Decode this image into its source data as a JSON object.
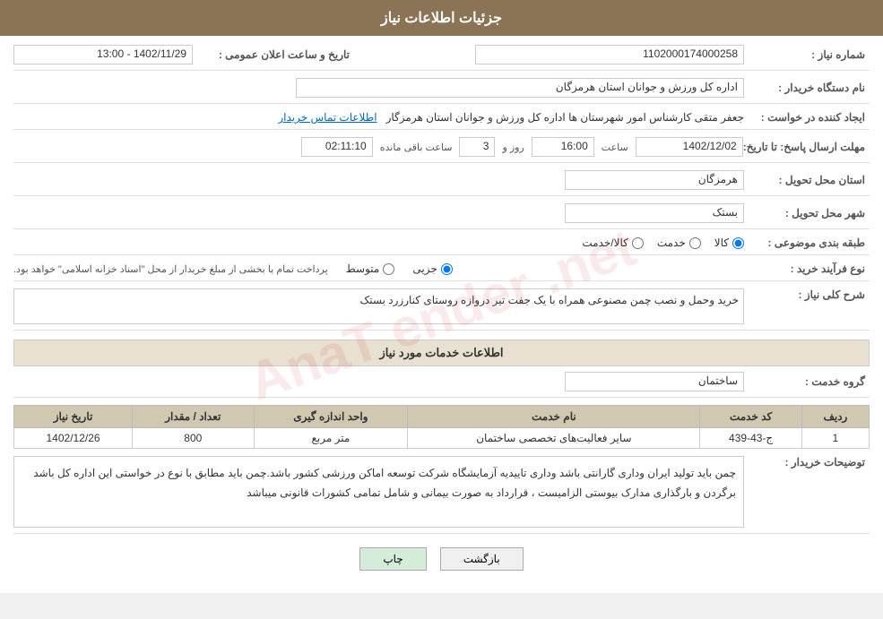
{
  "header": {
    "title": "جزئیات اطلاعات نیاز"
  },
  "fields": {
    "need_number_label": "شماره نیاز :",
    "need_number_value": "1102000174000258",
    "buyer_org_label": "نام دستگاه خریدار :",
    "buyer_org_value": "اداره کل ورزش و جوانان استان هرمزگان",
    "creator_label": "ایجاد کننده در خواست :",
    "creator_value": "جعفر متقی کارشناس امور شهرستان ها اداره کل ورزش و جوانان استان هرمزگار",
    "contact_link": "اطلاعات تماس خریدار",
    "send_deadline_label": "مهلت ارسال پاسخ: تا تاریخ:",
    "date_value": "1402/12/02",
    "time_label": "ساعت",
    "time_value": "16:00",
    "day_label": "روز و",
    "day_value": "3",
    "remaining_label": "ساعت باقی مانده",
    "remaining_value": "02:11:10",
    "province_label": "استان محل تحویل :",
    "province_value": "هرمزگان",
    "city_label": "شهر محل تحویل :",
    "city_value": "بستک",
    "category_label": "طبقه بندی موضوعی :",
    "category_kala": "کالا",
    "category_khedmat": "خدمت",
    "category_kala_khedmat": "کالا/خدمت",
    "process_label": "نوع فرآیند خرید :",
    "process_jozei": "جزیی",
    "process_motovaset": "متوسط",
    "process_description": "پرداخت تمام یا بخشی از مبلغ خریدار از محل \"اسناد خزانه اسلامی\" خواهد بود.",
    "need_summary_label": "شرح کلی نیاز :",
    "need_summary_value": "خرید وحمل  و نصب چمن مصنوعی همراه با یک جفت تیر دروازه روستای کنارزرد بستک",
    "services_header": "اطلاعات خدمات مورد نیاز",
    "service_group_label": "گروه خدمت :",
    "service_group_value": "ساختمان",
    "public_datetime_label": "تاریخ و ساعت اعلان عمومی :",
    "public_datetime_value": "1402/11/29 - 13:00",
    "table": {
      "headers": [
        "ردیف",
        "کد خدمت",
        "نام خدمت",
        "واحد اندازه گیری",
        "تعداد / مقدار",
        "تاریخ نیاز"
      ],
      "rows": [
        {
          "row": "1",
          "code": "ج-43-439",
          "name": "سایر فعالیت‌های تخصصی ساختمان",
          "unit": "متر مربع",
          "quantity": "800",
          "date": "1402/12/26"
        }
      ]
    },
    "buyer_notes_label": "توضیحات خریدار :",
    "buyer_notes_value": "چمن باید تولید ایران وداری گارانتی باشد وداری تاییدیه آزمایشگاه شرکت توسعه اماکن ورزشی کشور باشد.چمن باید مطابق با نوع در خواستی این اداره کل باشد برگردن و بارگذاری مدارک بیوستی الزامیست   ،  قرارداد به صورت بیمانی و شامل تمامی کشورات قانونی میباشد"
  },
  "buttons": {
    "print": "چاپ",
    "back": "بازگشت"
  }
}
